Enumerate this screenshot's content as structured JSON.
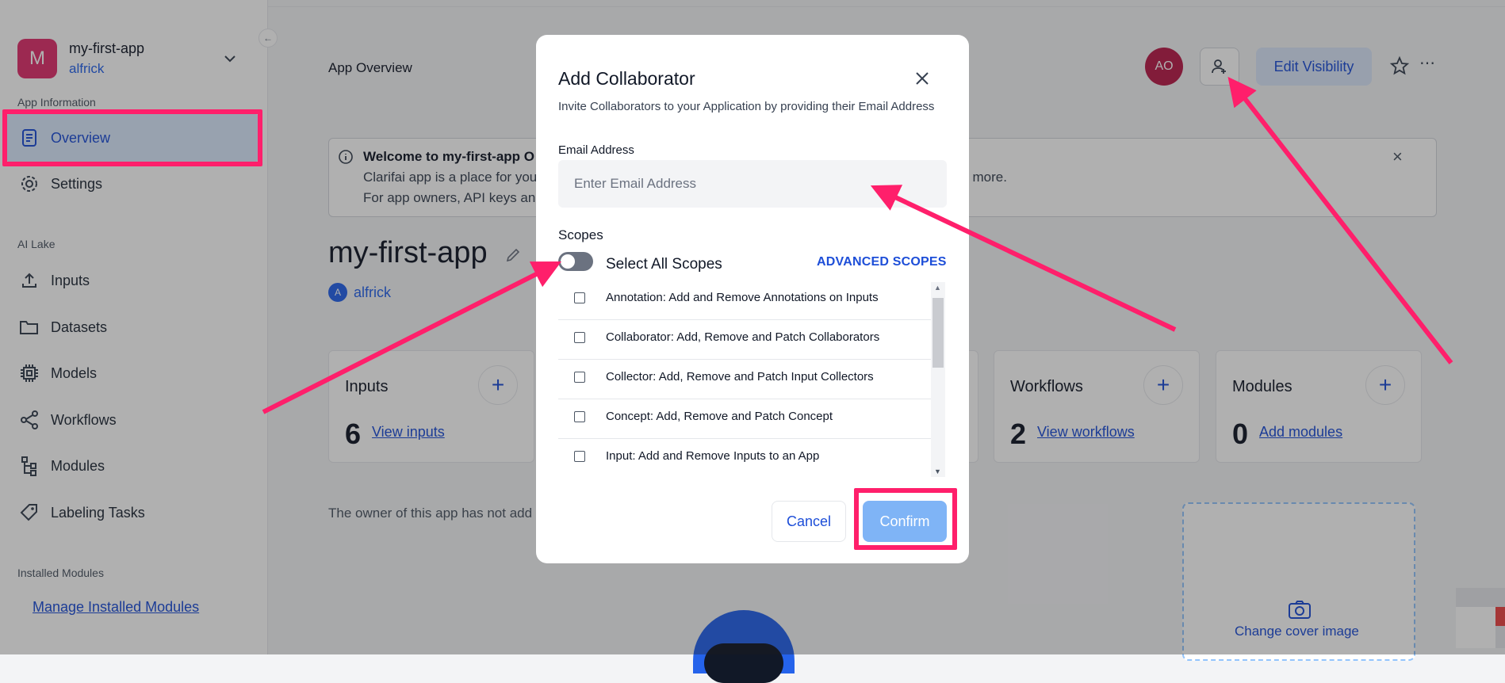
{
  "sidebar": {
    "app_initial": "M",
    "app_name": "my-first-app",
    "app_owner": "alfrick",
    "section_app_info": "App Information",
    "overview": "Overview",
    "settings": "Settings",
    "section_ai_lake": "AI Lake",
    "inputs": "Inputs",
    "datasets": "Datasets",
    "models": "Models",
    "workflows": "Workflows",
    "modules": "Modules",
    "labeling_tasks": "Labeling Tasks",
    "section_installed": "Installed Modules",
    "manage_installed": "Manage Installed Modules"
  },
  "header": {
    "title": "App Overview",
    "avatar_initials": "AO",
    "edit_visibility": "Edit Visibility"
  },
  "banner": {
    "title": "Welcome to my-first-app O",
    "line1": "Clarifai app is a place for you",
    "line2": "For app owners, API keys and",
    "line1_tail": "l more."
  },
  "app": {
    "title": "my-first-app",
    "owner_initial": "A",
    "owner": "alfrick"
  },
  "cards": {
    "inputs": {
      "title": "Inputs",
      "count": "6",
      "link": "View inputs"
    },
    "workflows": {
      "title": "Workflows",
      "count": "2",
      "link": "View workflows"
    },
    "modules": {
      "title": "Modules",
      "count": "0",
      "link": "Add modules"
    }
  },
  "owner_note": "The owner of this app has not add",
  "cover": {
    "label": "Change cover image"
  },
  "modal": {
    "title": "Add Collaborator",
    "subtitle": "Invite Collaborators to your Application by providing their Email Address",
    "email_label": "Email Address",
    "email_placeholder": "Enter Email Address",
    "email_value": "",
    "scopes_label": "Scopes",
    "select_all": "Select All Scopes",
    "select_all_on": false,
    "advanced": "ADVANCED SCOPES",
    "scopes": [
      {
        "label": "Annotation: Add and Remove Annotations on Inputs",
        "checked": false
      },
      {
        "label": "Collaborator: Add, Remove and Patch Collaborators",
        "checked": false
      },
      {
        "label": "Collector: Add, Remove and Patch Input Collectors",
        "checked": false
      },
      {
        "label": "Concept: Add, Remove and Patch Concept",
        "checked": false
      },
      {
        "label": "Input: Add and Remove Inputs to an App",
        "checked": false
      }
    ],
    "cancel": "Cancel",
    "confirm": "Confirm"
  },
  "colors": {
    "accent": "#1d4ed8",
    "highlight": "#ff1f6b",
    "app_badge": "#e0306d",
    "confirm_disabled": "#7fb4f6"
  }
}
